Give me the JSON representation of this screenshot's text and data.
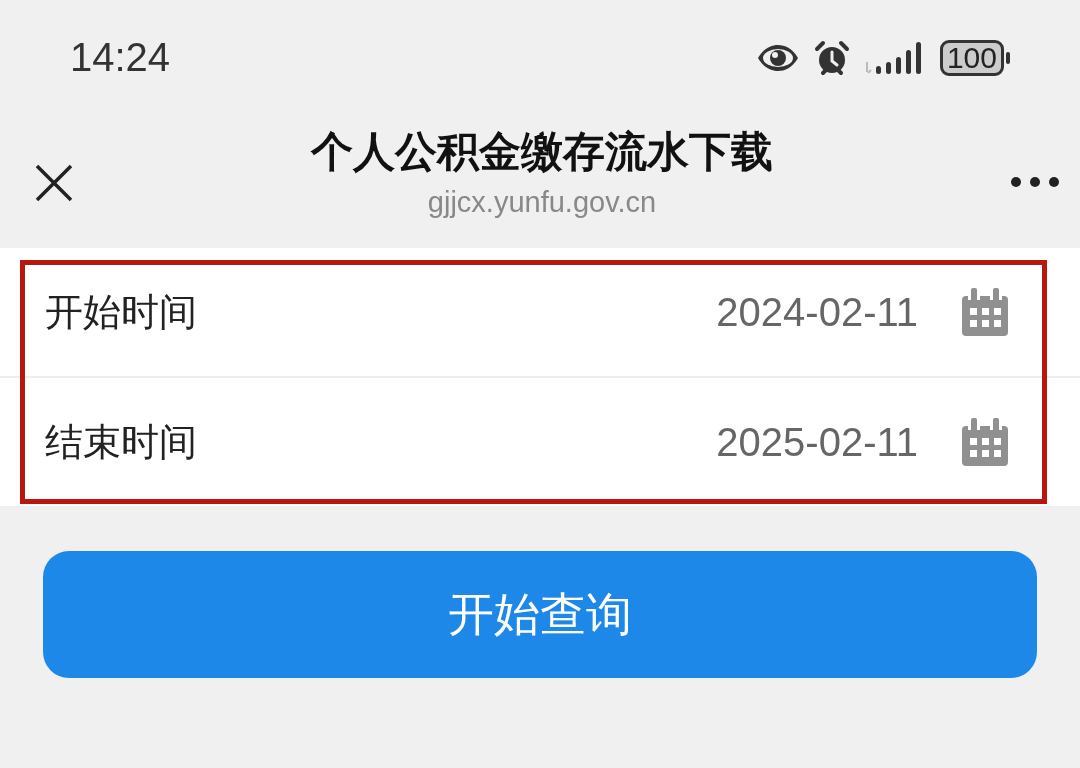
{
  "status_bar": {
    "time": "14:24",
    "battery": "100"
  },
  "header": {
    "title": "个人公积金缴存流水下载",
    "url": "gjjcx.yunfu.gov.cn"
  },
  "form": {
    "highlighted": true,
    "fields": [
      {
        "label": "开始时间",
        "value": "2024-02-11"
      },
      {
        "label": "结束时间",
        "value": "2025-02-11"
      }
    ]
  },
  "button": "开始查询"
}
